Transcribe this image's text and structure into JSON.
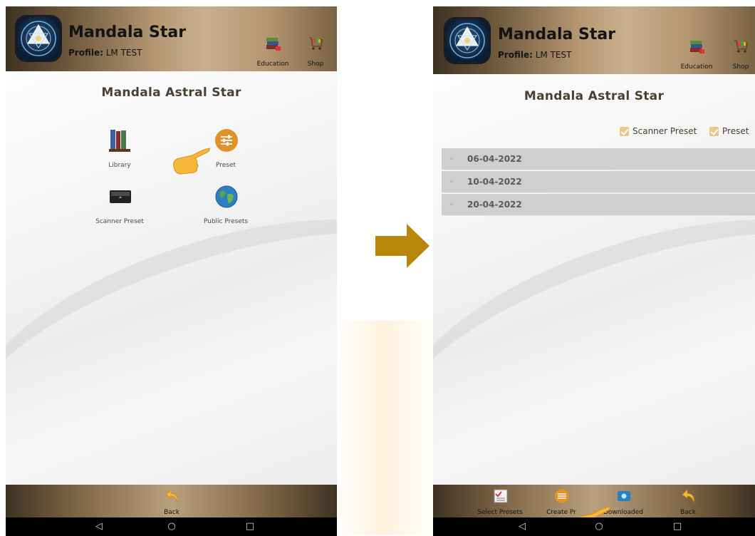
{
  "app": {
    "title": "Mandala Star",
    "profile_label": "Profile:",
    "profile_name": "LM TEST",
    "education_label": "Education",
    "shop_label": "Shop"
  },
  "left_screen": {
    "page_title": "Mandala Astral Star",
    "tiles": [
      {
        "label": "Library",
        "icon": "books-icon"
      },
      {
        "label": "Preset",
        "icon": "sliders-icon"
      },
      {
        "label": "Scanner Preset",
        "icon": "scanner-device-icon"
      },
      {
        "label": "Public Presets",
        "icon": "globe-icon"
      }
    ],
    "footer": {
      "back_label": "Back"
    }
  },
  "right_screen": {
    "page_title": "Mandala Astral Star",
    "filters": [
      {
        "label": "Scanner Preset",
        "checked": true
      },
      {
        "label": "Preset",
        "checked": true
      }
    ],
    "dates": [
      "06-04-2022",
      "10-04-2022",
      "20-04-2022"
    ],
    "footer": {
      "select_presets_label": "Select Presets",
      "create_preset_label": "Create Pr",
      "downloaded_label": "Downloaded",
      "back_label": "Back"
    }
  },
  "nav": {
    "back": "◁",
    "home": "○",
    "recents": "□"
  },
  "colors": {
    "header_gold": "#b49672",
    "accent_orange": "#e0912a",
    "title_brown": "#4b4032",
    "arrow": "#b8860b",
    "row_gray": "#cfcfcf"
  }
}
